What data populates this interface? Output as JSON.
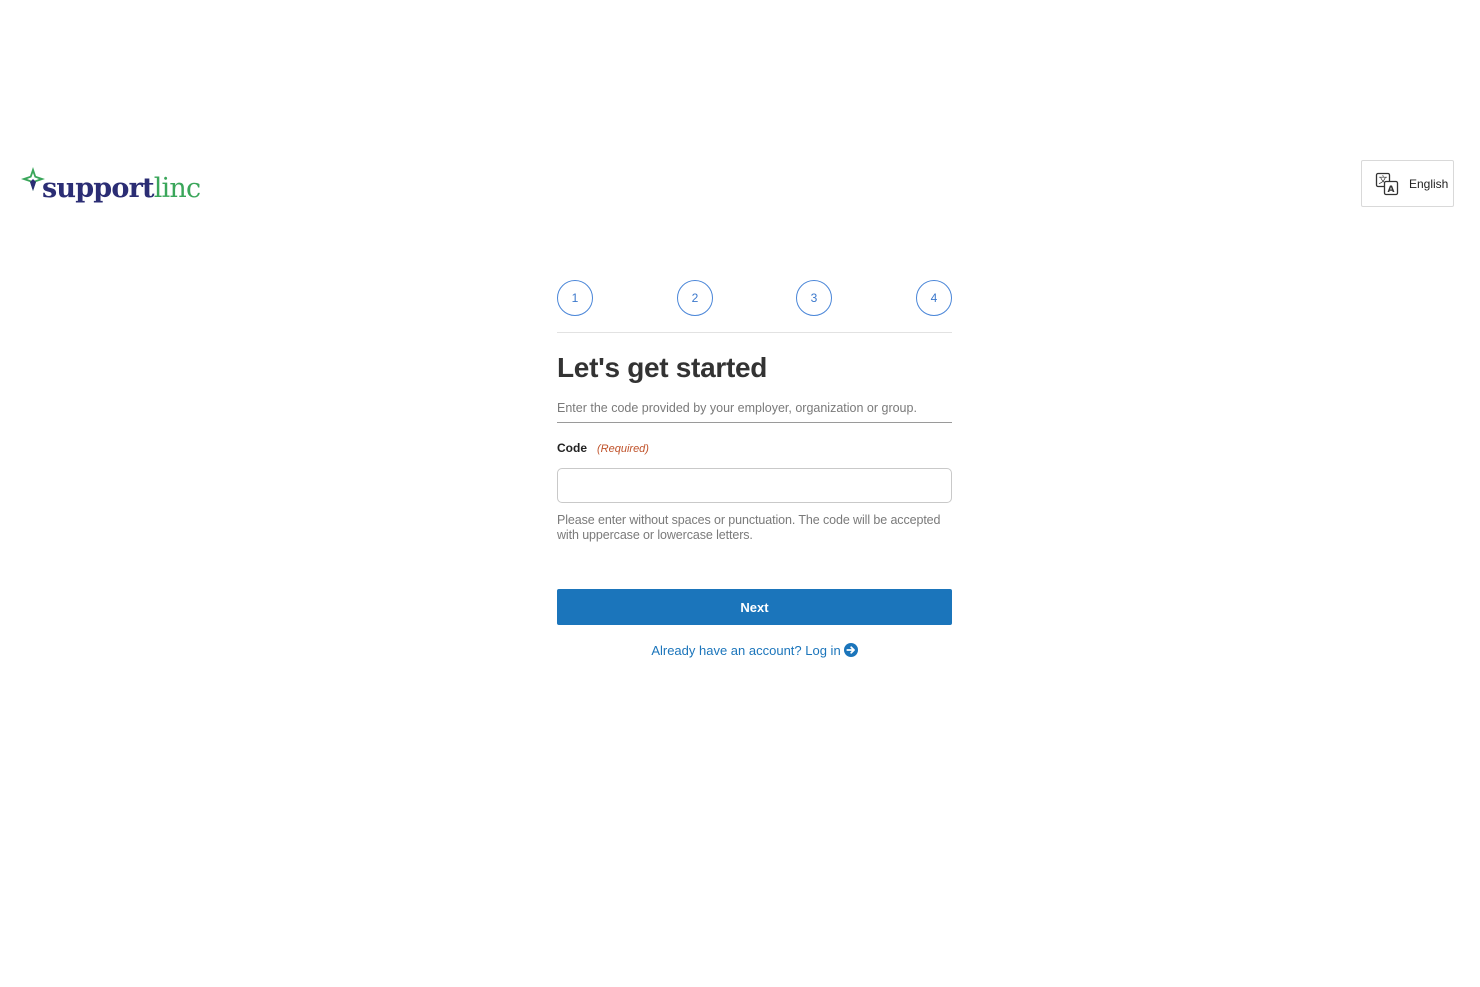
{
  "brand": {
    "logo_part1": "support",
    "logo_part2": "linc",
    "icon": "sparkle-star-icon",
    "colors": {
      "primary": "#2b2d74",
      "accent": "#3aa65a"
    }
  },
  "language": {
    "icon": "translate-icon",
    "label": "English"
  },
  "steps": [
    "1",
    "2",
    "3",
    "4"
  ],
  "form": {
    "title": "Let's get started",
    "subtitle": "Enter the code provided by your employer, organization or group.",
    "code_label": "Code",
    "required_label": "(Required)",
    "code_value": "",
    "help_text": "Please enter without spaces or punctuation. The code will be accepted with uppercase or lowercase letters.",
    "next_label": "Next",
    "login_text": "Already have an account? Log in",
    "login_icon": "arrow-circle-right-icon"
  },
  "colors": {
    "button": "#1b75bb",
    "step": "#4a86d8",
    "required": "#c0532b"
  }
}
